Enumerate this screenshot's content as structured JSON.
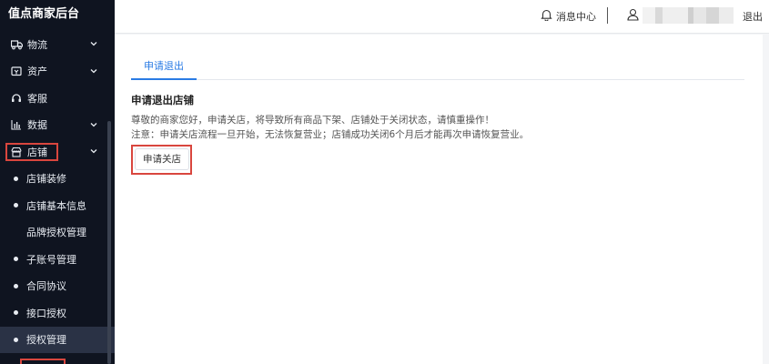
{
  "app": {
    "title": "值点商家后台"
  },
  "sidebar": {
    "items": [
      {
        "label": "物流",
        "icon": "truck-icon",
        "chevron": true
      },
      {
        "label": "资产",
        "icon": "wallet-icon",
        "chevron": true
      },
      {
        "label": "客服",
        "icon": "headset-icon",
        "chevron": false
      },
      {
        "label": "数据",
        "icon": "bar-chart-icon",
        "chevron": true
      },
      {
        "label": "店铺",
        "icon": "store-icon",
        "chevron": true,
        "expanded": true
      }
    ],
    "sub_items": [
      {
        "label": "店铺装修",
        "dot": true
      },
      {
        "label": "店铺基本信息",
        "dot": true
      },
      {
        "label": "品牌授权管理",
        "dot": false
      },
      {
        "label": "子账号管理",
        "dot": true
      },
      {
        "label": "合同协议",
        "dot": true
      },
      {
        "label": "接口授权",
        "dot": true
      },
      {
        "label": "授权管理",
        "dot": true
      }
    ]
  },
  "header": {
    "notice_label": "消息中心",
    "logout_label": "退出"
  },
  "main": {
    "tab_label": "申请退出",
    "section_title": "申请退出店铺",
    "description": "尊敬的商家您好，申请关店，将导致所有商品下架、店铺处于关闭状态，请慎重操作！",
    "notice": "注意：申请关店流程一旦开始，无法恢复营业；店铺成功关闭6个月后才能再次申请恢复营业。",
    "apply_button": "申请关店"
  },
  "colors": {
    "accent": "#2a7be4",
    "sidebar_bg": "#0f1420",
    "highlight": "#d9463e"
  }
}
